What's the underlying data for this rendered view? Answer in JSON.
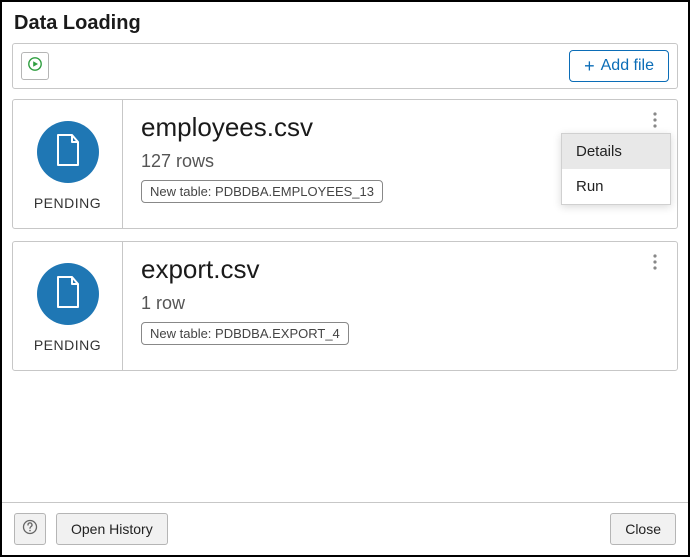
{
  "dialog": {
    "title": "Data Loading"
  },
  "toolbar": {
    "add_file_label": "Add file"
  },
  "files": [
    {
      "status": "PENDING",
      "name": "employees.csv",
      "rows": "127 rows",
      "target": "New table: PDBDBA.EMPLOYEES_13"
    },
    {
      "status": "PENDING",
      "name": "export.csv",
      "rows": "1 row",
      "target": "New table: PDBDBA.EXPORT_4"
    }
  ],
  "context_menu": {
    "details": "Details",
    "run": "Run"
  },
  "footer": {
    "open_history": "Open History",
    "close": "Close"
  }
}
